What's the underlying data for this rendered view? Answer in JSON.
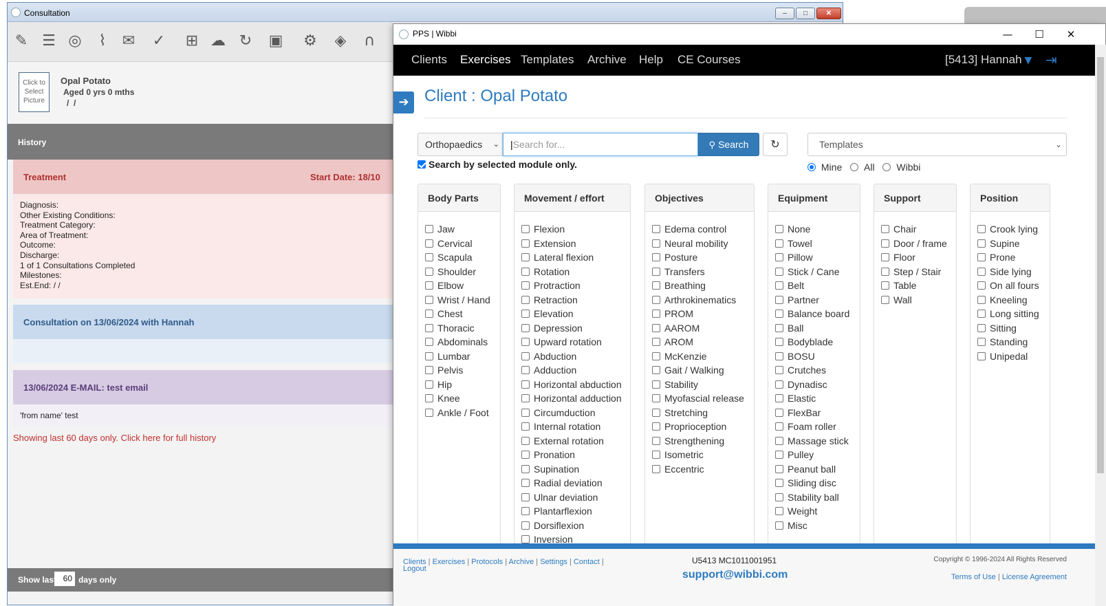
{
  "bg_window": {
    "title": "Consultation",
    "controls": [
      "–",
      "□",
      "✕"
    ],
    "toolbar_icons": [
      "notes-icon",
      "clipboard-icon",
      "webcam-icon",
      "attachment-icon",
      "mail-icon",
      "check-icon",
      "medical-kit-icon",
      "cloud-icon",
      "history-icon",
      "locked-folder-icon",
      "gear-icon",
      "grid-icon",
      "arch-icon"
    ],
    "patient": {
      "picture_placeholder": "Click to Select Picture",
      "name": "Opal Potato",
      "age": "Aged 0 yrs 0 mths",
      "dob": "/  /"
    },
    "history_label": "History",
    "treatment": {
      "title": "Treatment",
      "start_date": "Start Date: 18/10",
      "lines": [
        "Diagnosis:",
        "Other Existing Conditions:",
        "Treatment Category:",
        "Area of Treatment:",
        "Outcome:",
        "Discharge:",
        "1 of 1 Consultations Completed",
        "Milestones:",
        "Est.End: / /"
      ]
    },
    "consultation": {
      "title": "Consultation on 13/06/2024 with Hannah"
    },
    "email": {
      "title": "13/06/2024 E-MAIL: test email",
      "body": "'from name' test"
    },
    "history_link": "Showing last 60 days only. Click here for full history",
    "show_last": {
      "prefix": "Show last",
      "value": "60",
      "suffix": "days only"
    }
  },
  "fg_window": {
    "title": "PPS | Wibbi",
    "controls": [
      "—",
      "☐",
      "✕"
    ],
    "nav": {
      "items": [
        "Clients",
        "Exercises",
        "Templates",
        "Archive",
        "Help",
        "CE Courses"
      ],
      "active": "Exercises",
      "user": "[5413] Hannah"
    },
    "client_title": "Client : Opal Potato",
    "search": {
      "module": "Orthopaedics",
      "placeholder": "Search for...",
      "button": "Search",
      "module_only_label": "Search by selected module only.",
      "module_only_checked": true
    },
    "templates": {
      "select": "Templates",
      "options": [
        "Mine",
        "All",
        "Wibbi"
      ],
      "selected": "Mine"
    },
    "filters": [
      {
        "title": "Body Parts",
        "items": [
          "Jaw",
          "Cervical",
          "Scapula",
          "Shoulder",
          "Elbow",
          "Wrist / Hand",
          "Chest",
          "Thoracic",
          "Abdominals",
          "Lumbar",
          "Pelvis",
          "Hip",
          "Knee",
          "Ankle / Foot"
        ]
      },
      {
        "title": "Movement / effort",
        "items": [
          "Flexion",
          "Extension",
          "Lateral flexion",
          "Rotation",
          "Protraction",
          "Retraction",
          "Elevation",
          "Depression",
          "Upward rotation",
          "Abduction",
          "Adduction",
          "Horizontal abduction",
          "Horizontal adduction",
          "Circumduction",
          "Internal rotation",
          "External rotation",
          "Pronation",
          "Supination",
          "Radial deviation",
          "Ulnar deviation",
          "Plantarflexion",
          "Dorsiflexion",
          "Inversion"
        ]
      },
      {
        "title": "Objectives",
        "items": [
          "Edema control",
          "Neural mobility",
          "Posture",
          "Transfers",
          "Breathing",
          "Arthrokinematics",
          "PROM",
          "AAROM",
          "AROM",
          "McKenzie",
          "Gait / Walking",
          "Stability",
          "Myofascial release",
          "Stretching",
          "Proprioception",
          "Strengthening",
          "Isometric",
          "Eccentric"
        ]
      },
      {
        "title": "Equipment",
        "items": [
          "None",
          "Towel",
          "Pillow",
          "Stick / Cane",
          "Belt",
          "Partner",
          "Balance board",
          "Ball",
          "Bodyblade",
          "BOSU",
          "Crutches",
          "Dynadisc",
          "Elastic",
          "FlexBar",
          "Foam roller",
          "Massage stick",
          "Pulley",
          "Peanut ball",
          "Sliding disc",
          "Stability ball",
          "Weight",
          "Misc"
        ]
      },
      {
        "title": "Support",
        "items": [
          "Chair",
          "Door / frame",
          "Floor",
          "Step / Stair",
          "Table",
          "Wall"
        ]
      },
      {
        "title": "Position",
        "items": [
          "Crook lying",
          "Supine",
          "Prone",
          "Side lying",
          "On all fours",
          "Kneeling",
          "Long sitting",
          "Sitting",
          "Standing",
          "Unipedal"
        ]
      }
    ],
    "footer": {
      "links": [
        "Clients",
        "Exercises",
        "Protocols",
        "Archive",
        "Settings",
        "Contact"
      ],
      "logout": "Logout",
      "account": "U5413 MC1011001951",
      "support_email": "support@wibbi.com",
      "copyright": "Copyright © 1996-2024 All Rights Reserved",
      "terms": "Terms of Use",
      "license": "License Agreement"
    }
  },
  "colors": {
    "accent": "#2d7ac0",
    "treatment_bg": "#f2d3d3",
    "consult_bg": "#cfdef0",
    "email_bg": "#ddd3e6"
  }
}
